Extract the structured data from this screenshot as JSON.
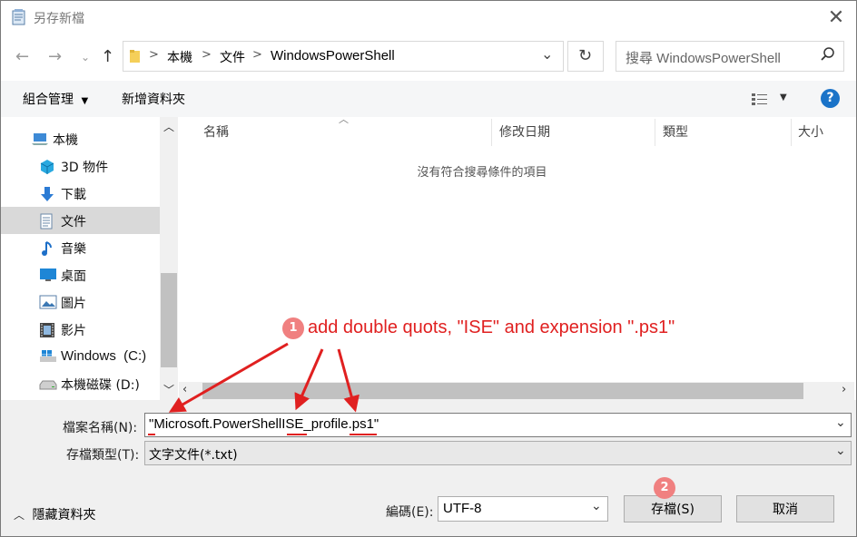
{
  "window": {
    "title": "另存新檔",
    "close_glyph": "✕"
  },
  "address_bar": {
    "breadcrumbs": [
      "本機",
      "文件",
      "WindowsPowerShell"
    ],
    "separator": ">",
    "search_placeholder": "搜尋 WindowsPowerShell"
  },
  "toolbar": {
    "organize_label": "組合管理",
    "new_folder_label": "新增資料夾",
    "help_glyph": "?"
  },
  "nav_pane": {
    "items": [
      {
        "label": "本機",
        "icon": "computer-icon"
      },
      {
        "label": "3D 物件",
        "icon": "cube-3d-icon"
      },
      {
        "label": "下載",
        "icon": "download-arrow-icon"
      },
      {
        "label": "文件",
        "icon": "document-icon",
        "selected": true
      },
      {
        "label": "音樂",
        "icon": "music-note-icon"
      },
      {
        "label": "桌面",
        "icon": "desktop-icon"
      },
      {
        "label": "圖片",
        "icon": "picture-icon"
      },
      {
        "label": "影片",
        "icon": "film-icon"
      },
      {
        "label": "Windows  (C:)",
        "icon": "windows-drive-icon"
      },
      {
        "label": "本機磁碟 (D:)",
        "icon": "disk-drive-icon"
      }
    ]
  },
  "file_list": {
    "columns": [
      "名稱",
      "修改日期",
      "類型",
      "大小"
    ],
    "empty_message": "沒有符合搜尋條件的項目"
  },
  "form": {
    "filename_label": "檔案名稱(N):",
    "filename_value": "\"Microsoft.PowerShellISE_profile.ps1\"",
    "filetype_label": "存檔類型(T):",
    "filetype_value": "文字文件(*.txt)",
    "encoding_label": "編碼(E):",
    "encoding_value": "UTF-8",
    "hide_folders_label": "隱藏資料夾",
    "save_label": "存檔(S)",
    "cancel_label": "取消"
  },
  "annotations": {
    "step1_badge": "1",
    "step1_text": "add double quots, \"ISE\" and expension \".ps1\"",
    "step2_badge": "2",
    "annotation_color": "#e02020"
  }
}
